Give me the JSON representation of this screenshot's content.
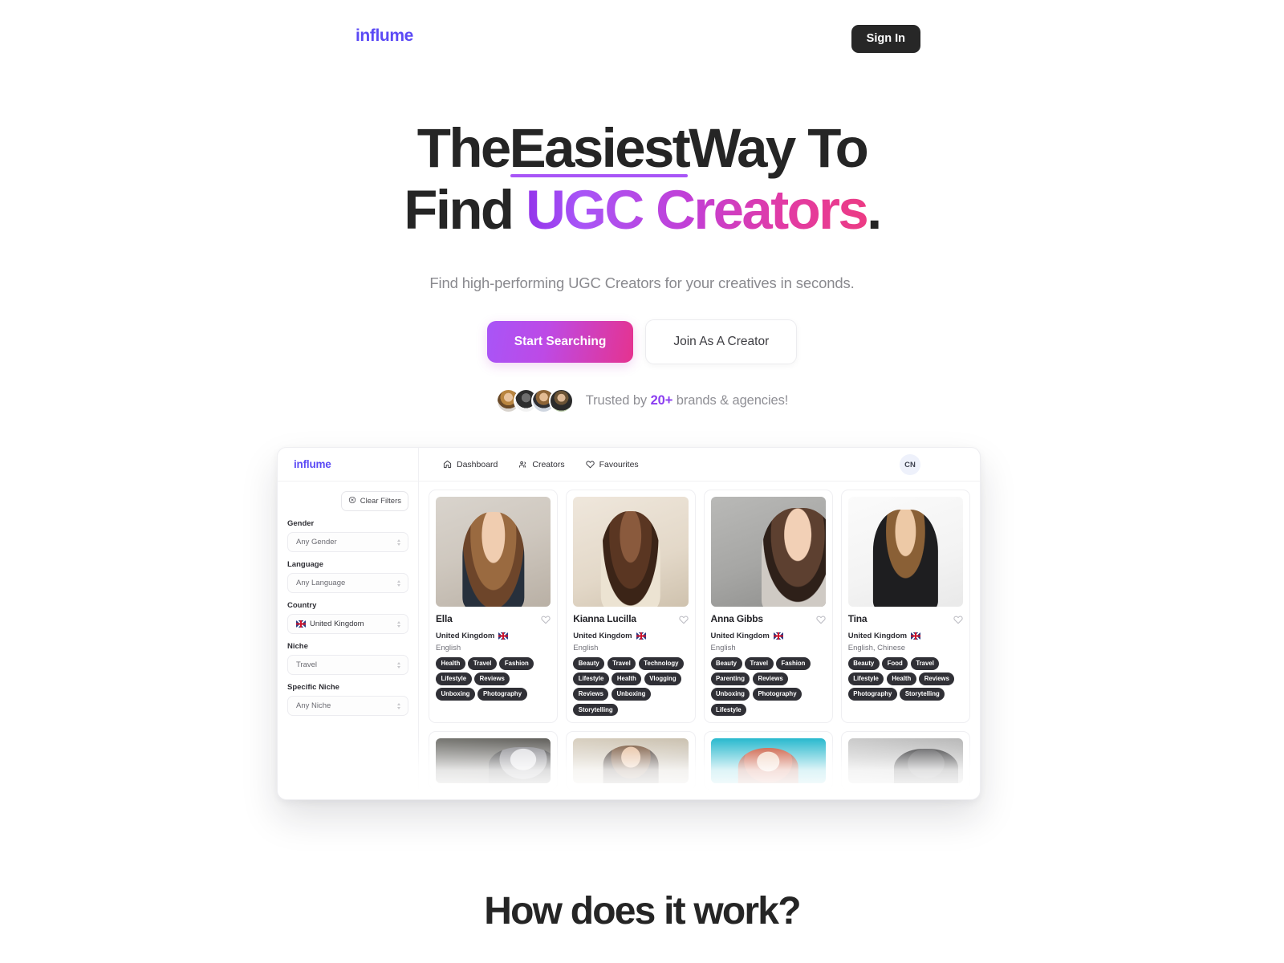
{
  "header": {
    "brand": "influme",
    "signin_label": "Sign In"
  },
  "hero": {
    "headline_part1": "The",
    "headline_underlined": "Easiest",
    "headline_part2": "Way To",
    "headline_part3": "Find",
    "headline_gradient": "UGC Creators",
    "headline_period": ".",
    "subhead": "Find high-performing UGC Creators for your creatives in seconds.",
    "primary_cta": "Start Searching",
    "secondary_cta": "Join As A Creator",
    "trust_prefix": "Trusted by ",
    "trust_count": "20+",
    "trust_suffix": " brands & agencies!"
  },
  "app": {
    "brand": "influme",
    "nav": [
      {
        "label": "Dashboard",
        "icon": "home-icon"
      },
      {
        "label": "Creators",
        "icon": "people-icon"
      },
      {
        "label": "Favourites",
        "icon": "heart-icon"
      }
    ],
    "avatar_initials": "CN",
    "sidebar": {
      "clear_filters_label": "Clear Filters",
      "filters": [
        {
          "label": "Gender",
          "value": "Any Gender",
          "flag": false
        },
        {
          "label": "Language",
          "value": "Any Language",
          "flag": false
        },
        {
          "label": "Country",
          "value": "United Kingdom",
          "flag": true
        },
        {
          "label": "Niche",
          "value": "Travel",
          "flag": false
        },
        {
          "label": "Specific Niche",
          "value": "Any Niche",
          "flag": false
        }
      ]
    },
    "creators": [
      {
        "name": "Ella",
        "country": "United Kingdom",
        "languages": "English",
        "tags": [
          "Health",
          "Travel",
          "Fashion",
          "Lifestyle",
          "Reviews",
          "Unboxing",
          "Photography"
        ]
      },
      {
        "name": "Kianna Lucilla",
        "country": "United Kingdom",
        "languages": "English",
        "tags": [
          "Beauty",
          "Travel",
          "Technology",
          "Lifestyle",
          "Health",
          "Vlogging",
          "Reviews",
          "Unboxing",
          "Storytelling"
        ]
      },
      {
        "name": "Anna Gibbs",
        "country": "United Kingdom",
        "languages": "English",
        "tags": [
          "Beauty",
          "Travel",
          "Fashion",
          "Parenting",
          "Reviews",
          "Unboxing",
          "Photography",
          "Lifestyle"
        ]
      },
      {
        "name": "Tina",
        "country": "United Kingdom",
        "languages": "English, Chinese",
        "tags": [
          "Beauty",
          "Food",
          "Travel",
          "Lifestyle",
          "Health",
          "Reviews",
          "Photography",
          "Storytelling"
        ]
      }
    ]
  },
  "how_it_works": {
    "title": "How does it work?"
  },
  "colors": {
    "brand_purple": "#5b4af5",
    "accent_purple": "#a855f7",
    "accent_pink": "#ec3b84",
    "dark": "#272727",
    "tag_bg": "#303036"
  }
}
